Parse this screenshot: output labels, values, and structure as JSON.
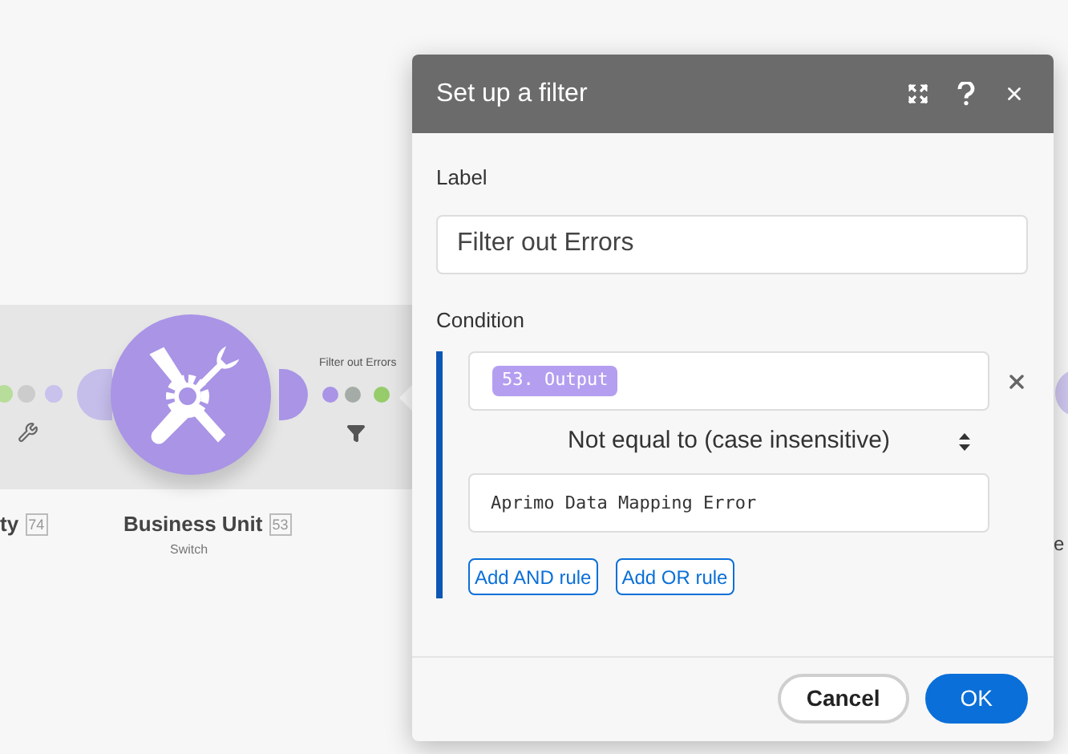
{
  "canvas": {
    "route_label": "Filter out Errors",
    "modules": [
      {
        "name": "ty",
        "badge": "74"
      },
      {
        "name": "Business Unit",
        "badge": "53",
        "type": "Switch"
      },
      {
        "name": "e"
      }
    ]
  },
  "dialog": {
    "title": "Set up a filter",
    "label_caption": "Label",
    "label_value": "Filter out Errors",
    "condition_caption": "Condition",
    "condition": {
      "operand": "53. Output",
      "operator": "Not equal to (case insensitive)",
      "value": "Aprimo Data Mapping Error"
    },
    "rule_buttons": [
      "Add AND rule",
      "Add OR rule"
    ],
    "buttons": [
      {
        "label": "Cancel",
        "kind": "secondary"
      },
      {
        "label": "OK",
        "kind": "primary"
      }
    ]
  }
}
